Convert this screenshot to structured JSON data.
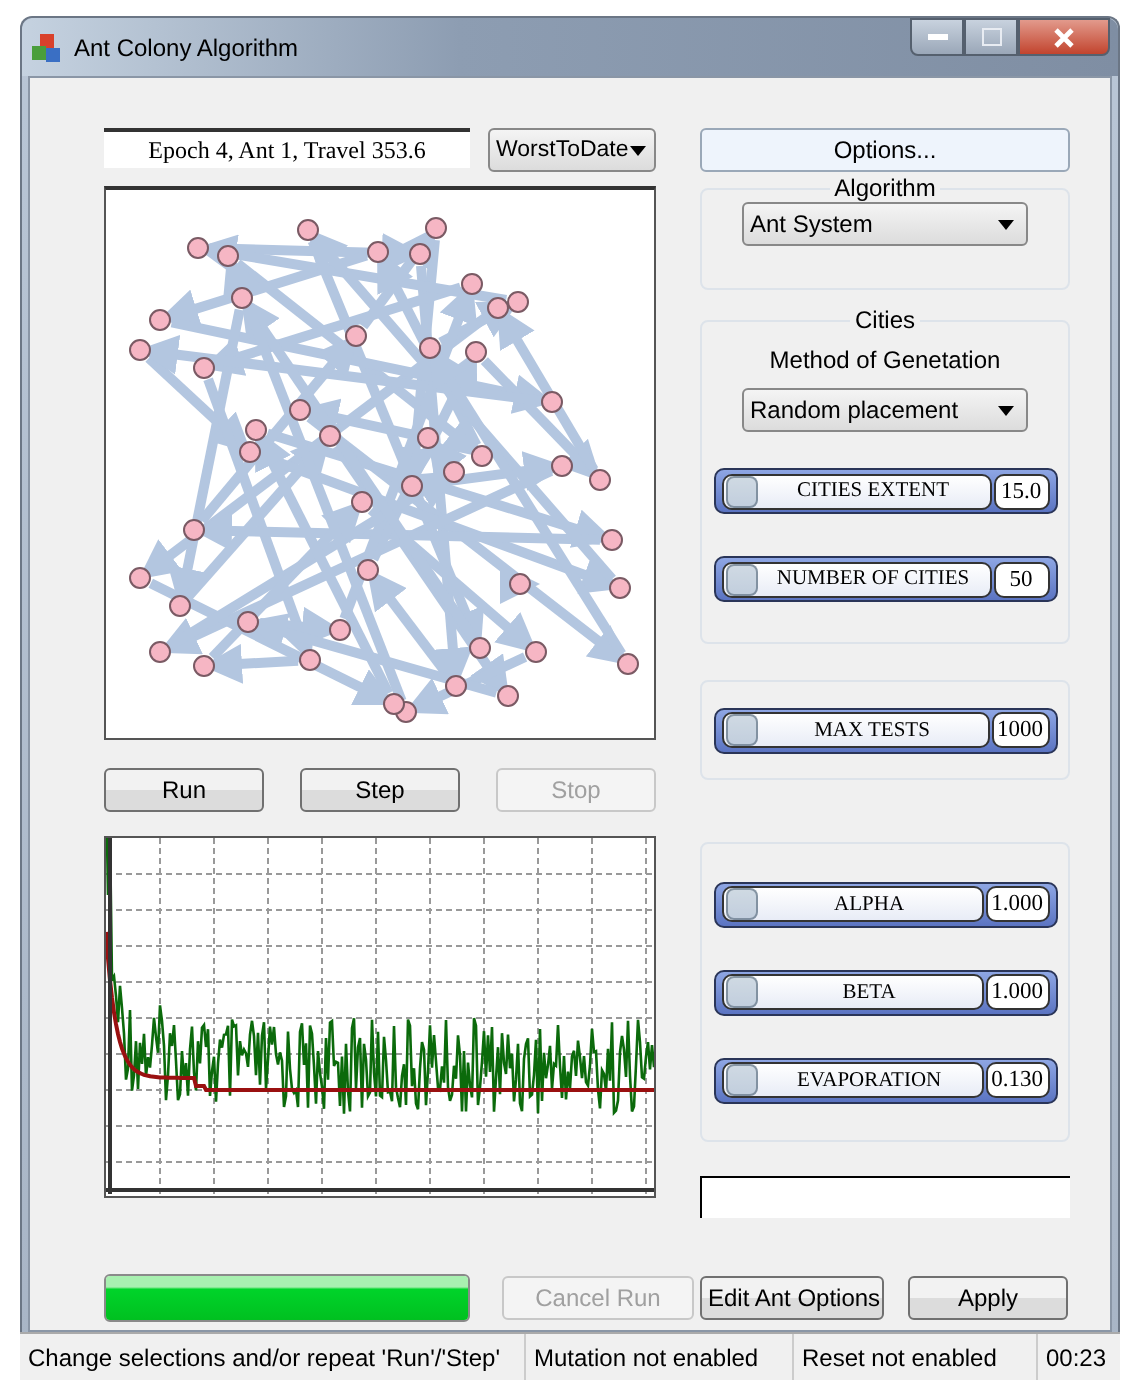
{
  "window": {
    "title": "Ant Colony Algorithm"
  },
  "epoch_field": {
    "value": "Epoch  4, Ant 1, Travel 353.6"
  },
  "view_select": {
    "value": "WorstToDate"
  },
  "run_buttons": [
    {
      "label": "Run",
      "disabled": false
    },
    {
      "label": "Step",
      "disabled": false
    },
    {
      "label": "Stop",
      "disabled": true
    }
  ],
  "options_button": {
    "label": "Options..."
  },
  "algorithm": {
    "title": "Algorithm",
    "value": "Ant System"
  },
  "cities": {
    "title": "Cities",
    "method_label": "Method of Genetation",
    "method": "Random placement",
    "sliders": [
      {
        "label": "CITIES EXTENT",
        "value": "15.0"
      },
      {
        "label": "NUMBER OF CITIES",
        "value": "50"
      }
    ]
  },
  "tests": {
    "sliders": [
      {
        "label": "MAX TESTS",
        "value": "1000"
      }
    ]
  },
  "parameters": {
    "sliders": [
      {
        "label": "ALPHA",
        "value": "1.000"
      },
      {
        "label": "BETA",
        "value": "1.000"
      },
      {
        "label": "EVAPORATION",
        "value": "0.130"
      }
    ]
  },
  "progress": {
    "level": 1.0
  },
  "bottom_buttons": [
    {
      "label": "Cancel Run",
      "disabled": true
    },
    {
      "label": "Edit Ant Options",
      "disabled": false
    },
    {
      "label": "Apply",
      "disabled": false
    }
  ],
  "status_bar": [
    "Change selections and/or repeat 'Run'/'Step'",
    "Mutation not enabled",
    "Reset not enabled",
    "00:23"
  ]
}
